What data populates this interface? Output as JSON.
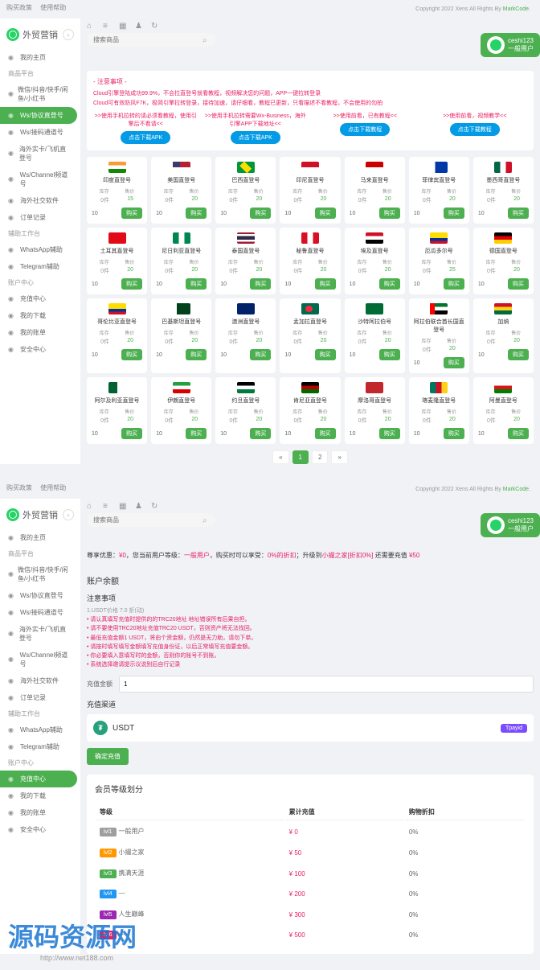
{
  "brand": "外贸营销",
  "topbar": {
    "policy": "购买政策",
    "help": "使用帮助",
    "copyright": "Copyright 2022 Xens All Rights By",
    "copyright_link": "MarkCode"
  },
  "user": {
    "name": "ceshi123",
    "level": "一般用户"
  },
  "search": {
    "placeholder": "搜索商品"
  },
  "sidebar": {
    "home": "我的主页",
    "group1_title": "商品平台",
    "items1": [
      {
        "label": "微信/抖音/快手/闲鱼/小红书"
      },
      {
        "label": "Ws/协议直登号"
      },
      {
        "label": "Ws/接码通道号"
      },
      {
        "label": "海外实卡/飞机直登号"
      },
      {
        "label": "Ws/Channel频道号"
      },
      {
        "label": "海外社交软件"
      },
      {
        "label": "订单记录"
      }
    ],
    "group2_title": "辅助工作台",
    "items2": [
      {
        "label": "WhatsApp辅助"
      },
      {
        "label": "Telegram辅助"
      }
    ],
    "group3_title": "账户中心",
    "items3": [
      {
        "label": "充值中心"
      },
      {
        "label": "我的下载"
      },
      {
        "label": "我的账单"
      },
      {
        "label": "安全中心"
      }
    ]
  },
  "notice": {
    "title": "- 注意事项 -",
    "line1": "Cloud引擎登陆成功99.9%，不会拉直登号就看教程，视频解决您的问题，APP一键拉转登录",
    "line2": "Cloud可有效防风F7K，极简引擎拉转登录，接待加速，请仔细看，教程已更新，只看描述不看教程，不会使用的勿拍",
    "banners": [
      {
        "text": ">>使用手机拉转的请必须看教程，使用引擎后不看请<<",
        "btn": "点击下载APK"
      },
      {
        "text": ">>使用手机拉转需要Wx-Business，海外引擎APP下载地址<<",
        "btn": "点击下载APK"
      },
      {
        "text": ">>使用前看，已有教程<<",
        "btn": "点击下载教程"
      },
      {
        "text": ">>使用前看，视频教学<<",
        "btn": "点击下载教程"
      }
    ]
  },
  "labels": {
    "stock": "库存",
    "price": "售价",
    "buy": "购买",
    "qty": "10"
  },
  "products": [
    {
      "name": "印度直登号",
      "flag": "f-in",
      "stock": "0件",
      "price": "15"
    },
    {
      "name": "美国直登号",
      "flag": "f-us",
      "stock": "0件",
      "price": "20"
    },
    {
      "name": "巴西直登号",
      "flag": "f-br",
      "stock": "0件",
      "price": "20"
    },
    {
      "name": "印尼直登号",
      "flag": "f-id",
      "stock": "0件",
      "price": "20"
    },
    {
      "name": "马来直登号",
      "flag": "f-my",
      "stock": "0件",
      "price": "20"
    },
    {
      "name": "菲律宾直登号",
      "flag": "f-ph",
      "stock": "0件",
      "price": "20"
    },
    {
      "name": "墨西哥直登号",
      "flag": "f-mx",
      "stock": "0件",
      "price": "20"
    },
    {
      "name": "土耳其直登号",
      "flag": "f-tr",
      "stock": "0件",
      "price": "20"
    },
    {
      "name": "尼日利亚直登号",
      "flag": "f-ng",
      "stock": "0件",
      "price": "20"
    },
    {
      "name": "泰国直登号",
      "flag": "f-th",
      "stock": "0件",
      "price": "20"
    },
    {
      "name": "秘鲁直登号",
      "flag": "f-pe",
      "stock": "0件",
      "price": "20"
    },
    {
      "name": "埃及直登号",
      "flag": "f-eg",
      "stock": "0件",
      "price": "20"
    },
    {
      "name": "厄瓜多尔号",
      "flag": "f-ec",
      "stock": "0件",
      "price": "25"
    },
    {
      "name": "德国直登号",
      "flag": "f-de",
      "stock": "0件",
      "price": "20"
    },
    {
      "name": "哥伦比亚直登号",
      "flag": "f-co",
      "stock": "0件",
      "price": "20"
    },
    {
      "name": "巴基斯坦直登号",
      "flag": "f-pk",
      "stock": "0件",
      "price": "20"
    },
    {
      "name": "澳洲直登号",
      "flag": "f-au",
      "stock": "0件",
      "price": "20"
    },
    {
      "name": "孟加拉直登号",
      "flag": "f-bd",
      "stock": "0件",
      "price": "20"
    },
    {
      "name": "沙特阿拉伯号",
      "flag": "f-sa",
      "stock": "0件",
      "price": "20"
    },
    {
      "name": "阿拉伯联合酋长国直登号",
      "flag": "f-ae",
      "stock": "0件",
      "price": "20"
    },
    {
      "name": "加纳",
      "flag": "f-gh",
      "stock": "0件",
      "price": "20"
    },
    {
      "name": "阿尔及利亚直登号",
      "flag": "f-dz",
      "stock": "0件",
      "price": "20"
    },
    {
      "name": "伊朗直登号",
      "flag": "f-ir",
      "stock": "0件",
      "price": "20"
    },
    {
      "name": "约旦直登号",
      "flag": "f-jo",
      "stock": "0件",
      "price": "20"
    },
    {
      "name": "肯尼亚直登号",
      "flag": "f-ke",
      "stock": "0件",
      "price": "20"
    },
    {
      "name": "摩洛哥直登号",
      "flag": "f-ma",
      "stock": "0件",
      "price": "20"
    },
    {
      "name": "喀麦隆直登号",
      "flag": "f-cm",
      "stock": "0件",
      "price": "20"
    },
    {
      "name": "阿曼直登号",
      "flag": "f-om",
      "stock": "0件",
      "price": "20"
    }
  ],
  "pagination": {
    "prev": "«",
    "p1": "1",
    "p2": "2",
    "next": "»"
  },
  "recharge": {
    "balance_title": "账户余额",
    "sub_title": "注意事项",
    "promo": {
      "prefix": "尊享优惠：",
      "amt": "¥0",
      "mid": "，您当前用户等级：",
      "lvl": "一般用户",
      "mid2": "，购买时可以享受：",
      "pct": "0%的折扣",
      "mid3": "；升级到",
      "next": "小撮之家[折扣0%]",
      "mid4": " 还需要充值 ",
      "need": "¥50"
    },
    "warns": [
      "1.USDT价格 7.0 折(动)",
      "• 请认真填写充值时提供的的TRC20地址 地址错误所有后果自担。",
      "• 请不要使用TRC20地址充值TRC20 USDT，否则资产将无法找回。",
      "• 最低充值金额1 USDT，将由个资金额，仍然是无力助，请勿下单。",
      "• 请按时填写填写金额填写充值身份证，以后正常填写充值要金额。",
      "• 你必要填入意填写时的金额，否则你的账号不到账。",
      "• 系统选择邀请提示议说别后自行记录"
    ],
    "amount_label": "充值金额",
    "amount_value": "1",
    "channel_title": "充值渠道",
    "channel_name": "USDT",
    "channel_tag": "Tpayid",
    "confirm": "确定充值"
  },
  "levels": {
    "title": "会员等级划分",
    "headers": {
      "level": "等级",
      "total": "累计充值",
      "discount": "购物折扣"
    },
    "rows": [
      {
        "badge": "b1",
        "blabel": "lvl1",
        "name": "一般用户",
        "total": "¥ 0",
        "discount": "0%"
      },
      {
        "badge": "b2",
        "blabel": "lvl2",
        "name": "小撮之家",
        "total": "¥ 50",
        "discount": "0%"
      },
      {
        "badge": "b3",
        "blabel": "lvl3",
        "name": "携满天涯",
        "total": "¥ 100",
        "discount": "0%"
      },
      {
        "badge": "b4",
        "blabel": "lvl4",
        "name": "—",
        "total": "¥ 200",
        "discount": "0%"
      },
      {
        "badge": "b5",
        "blabel": "lvl5",
        "name": "人生巅峰",
        "total": "¥ 300",
        "discount": "0%"
      },
      {
        "badge": "b6",
        "blabel": "lvl6",
        "name": "—",
        "total": "¥ 500",
        "discount": "0%"
      }
    ]
  },
  "watermark": {
    "main": "源码资源网",
    "sub": "http://www.net188.com"
  }
}
